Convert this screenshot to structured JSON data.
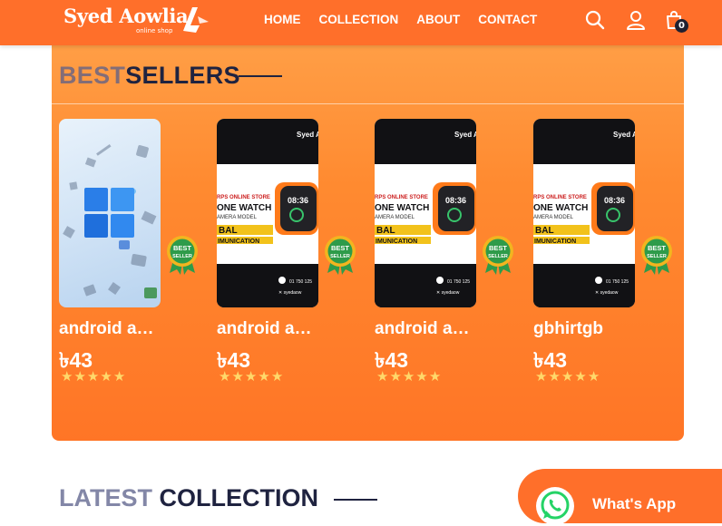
{
  "header": {
    "logo_text": "Syed Aowlia",
    "logo_subtitle": "online shop",
    "nav": [
      {
        "label": "HOME"
      },
      {
        "label": "COLLECTION"
      },
      {
        "label": "ABOUT"
      },
      {
        "label": "CONTACT"
      }
    ],
    "icons": [
      "search-icon",
      "user-icon",
      "shopping-bag-icon"
    ],
    "cart_count": "0"
  },
  "bestsellers": {
    "title_light": "BEST",
    "title_dark": "SELLERS",
    "products": [
      {
        "name": "android and ios",
        "price": "৳43",
        "rating": 5,
        "image": "windows-wallpaper",
        "badge": "BEST SELLER"
      },
      {
        "name": "android and ios",
        "price": "৳43",
        "rating": 5,
        "image": "smartwatch-banner",
        "badge": "BEST SELLER"
      },
      {
        "name": "android and ios",
        "price": "৳43",
        "rating": 5,
        "image": "smartwatch-banner",
        "badge": "BEST SELLER"
      },
      {
        "name": "gbhirtgb",
        "price": "৳43",
        "rating": 5,
        "image": "smartwatch-banner",
        "badge": "BEST SELLER"
      }
    ]
  },
  "latest": {
    "title_light": "LATEST",
    "title_dark": "COLLECTION"
  },
  "whatsapp": {
    "label": "What's App"
  },
  "colors": {
    "brand_orange": "#ff6f2a",
    "panel_orange": "#ff8a30",
    "dark_text": "#1f2340",
    "star_yellow": "#ffd86a"
  }
}
